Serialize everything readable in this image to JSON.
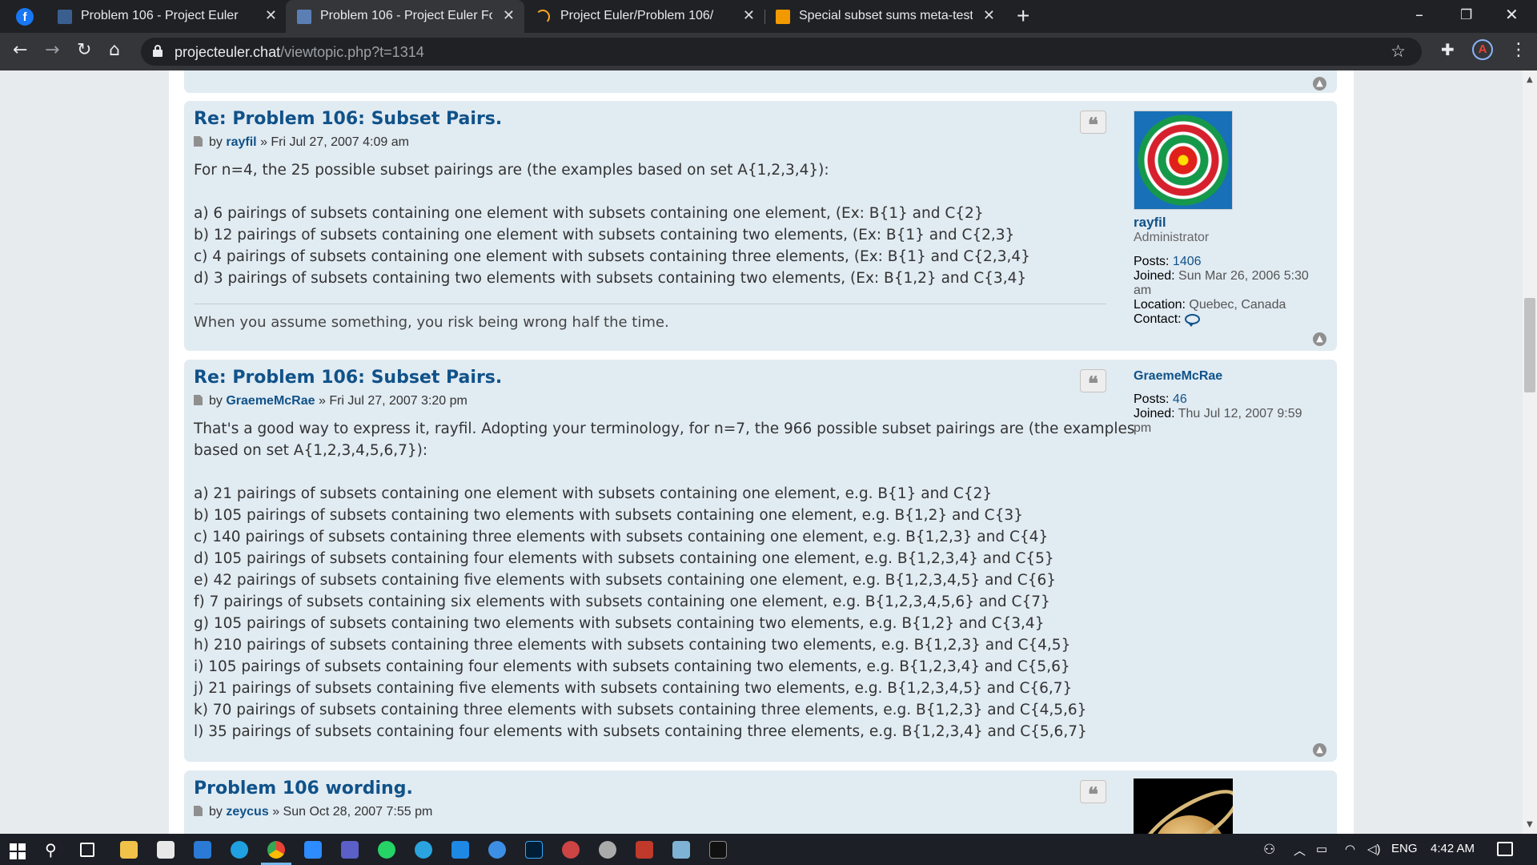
{
  "browser": {
    "tabs": [
      {
        "title": "Problem 106 - Project Euler",
        "favicon": "project-euler-icon",
        "active": false
      },
      {
        "title": "Problem 106 - Project Euler Forum",
        "favicon": "project-euler-forum-icon",
        "active": true
      },
      {
        "title": "Project Euler/Problem 106/",
        "favicon": "loading-spinner-icon",
        "active": false
      },
      {
        "title": "Special subset sums meta-testing",
        "favicon": "book-icon",
        "active": false
      }
    ],
    "new_tab": "+",
    "url_host": "projecteuler.chat",
    "url_path": "/viewtopic.php?t=1314",
    "profile_letter": "A"
  },
  "posts": [
    {
      "title": "Re: Problem 106: Subset Pairs.",
      "by": "by",
      "author": "rayfil",
      "date": "» Fri Jul 27, 2007 4:09 am",
      "lines": [
        "For n=4, the 25 possible subset pairings are (the examples based on set A{1,2,3,4}):",
        "",
        "a) 6 pairings of subsets containing one element with subsets containing one element, (Ex: B{1} and C{2}",
        "b) 12 pairings of subsets containing one element with subsets containing two elements, (Ex: B{1} and C{2,3}",
        "c) 4 pairings of subsets containing one element with subsets containing three elements, (Ex: B{1} and C{2,3,4}",
        "d) 3 pairings of subsets containing two elements with subsets containing two elements, (Ex: B{1,2} and C{3,4}"
      ],
      "signature": "When you assume something, you risk being wrong half the time.",
      "profile": {
        "username": "rayfil",
        "rank": "Administrator",
        "posts_label": "Posts:",
        "posts": "1406",
        "joined_label": "Joined:",
        "joined": "Sun Mar 26, 2006 5:30",
        "joined_cont": "am",
        "location_label": "Location:",
        "location": "Quebec, Canada",
        "contact_label": "Contact:"
      }
    },
    {
      "title": "Re: Problem 106: Subset Pairs.",
      "by": "by",
      "author": "GraemeMcRae",
      "date": "» Fri Jul 27, 2007 3:20 pm",
      "lines": [
        "That's a good way to express it, rayfil. Adopting your terminology, for n=7, the 966 possible subset pairings are (the examples",
        "based on set A{1,2,3,4,5,6,7}):",
        "",
        "a) 21 pairings of subsets containing one element with subsets containing one element, e.g. B{1} and C{2}",
        "b) 105 pairings of subsets containing two elements with subsets containing one element, e.g. B{1,2} and C{3}",
        "c) 140 pairings of subsets containing three elements with subsets containing one element, e.g. B{1,2,3} and C{4}",
        "d) 105 pairings of subsets containing four elements with subsets containing one element, e.g. B{1,2,3,4} and C{5}",
        "e) 42 pairings of subsets containing five elements with subsets containing one element, e.g. B{1,2,3,4,5} and C{6}",
        "f) 7 pairings of subsets containing six elements with subsets containing one element, e.g. B{1,2,3,4,5,6} and C{7}",
        "g) 105 pairings of subsets containing two elements with subsets containing two elements, e.g. B{1,2} and C{3,4}",
        "h) 210 pairings of subsets containing three elements with subsets containing two elements, e.g. B{1,2,3} and C{4,5}",
        "i) 105 pairings of subsets containing four elements with subsets containing two elements, e.g. B{1,2,3,4} and C{5,6}",
        "j) 21 pairings of subsets containing five elements with subsets containing two elements, e.g. B{1,2,3,4,5} and C{6,7}",
        "k) 70 pairings of subsets containing three elements with subsets containing three elements, e.g. B{1,2,3} and C{4,5,6}",
        "l) 35 pairings of subsets containing four elements with subsets containing three elements, e.g. B{1,2,3,4} and C{5,6,7}"
      ],
      "profile": {
        "username": "GraemeMcRae",
        "posts_label": "Posts:",
        "posts": "46",
        "joined_label": "Joined:",
        "joined": "Thu Jul 12, 2007 9:59",
        "joined_cont": "pm"
      }
    },
    {
      "title": "Problem 106 wording.",
      "by": "by",
      "author": "zeycus",
      "date": "» Sun Oct 28, 2007 7:55 pm"
    }
  ],
  "quote_icon": "❝",
  "top_icon": "▲",
  "taskbar": {
    "language": "ENG",
    "time": "4:42 AM"
  }
}
